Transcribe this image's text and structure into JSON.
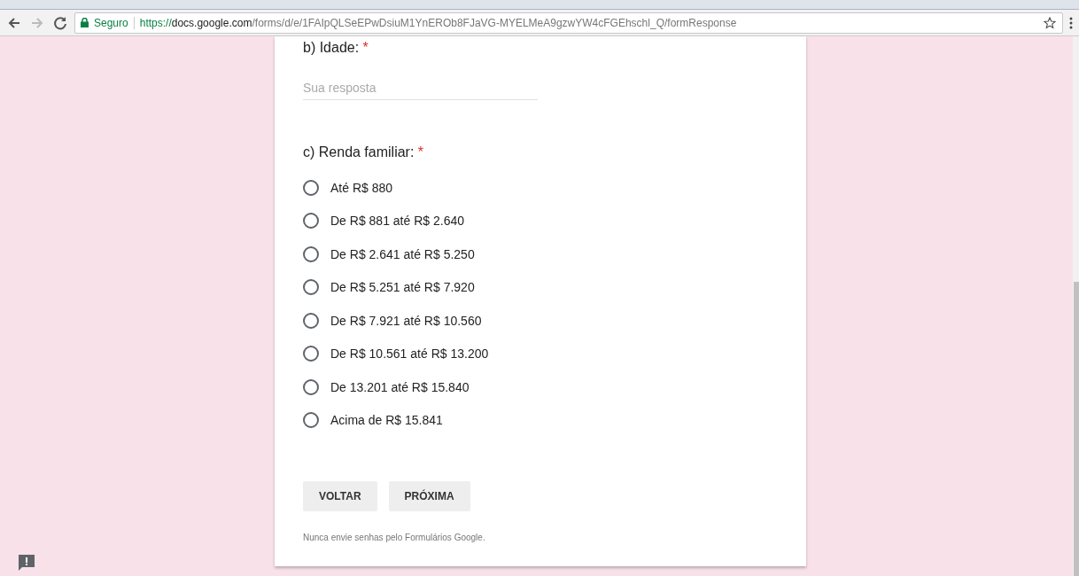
{
  "browser": {
    "security_label": "Seguro",
    "url": {
      "scheme": "https://",
      "host": "docs.google.com",
      "path": "/forms/d/e/1FAIpQLSeEPwDsiuM1YnEROb8FJaVG-MYELMeA9gzwYW4cFGEhschl_Q/formResponse"
    }
  },
  "form": {
    "questions": [
      {
        "kind": "text",
        "title": "b) Idade:",
        "required_mark": "*",
        "placeholder": "Sua resposta"
      },
      {
        "kind": "radio",
        "title": "c) Renda familiar:",
        "required_mark": "*",
        "options": [
          {
            "label": "Até R$ 880",
            "selected": false
          },
          {
            "label": "De R$ 881 até R$ 2.640",
            "selected": false
          },
          {
            "label": "De R$ 2.641 até R$ 5.250",
            "selected": false
          },
          {
            "label": "De R$ 5.251 até R$ 7.920",
            "selected": false
          },
          {
            "label": "De R$ 7.921 até R$ 10.560",
            "selected": false
          },
          {
            "label": "De R$ 10.561 até R$ 13.200",
            "selected": false
          },
          {
            "label": "De 13.201 até R$ 15.840",
            "selected": false
          },
          {
            "label": "Acima de R$ 15.841",
            "selected": false
          }
        ]
      }
    ],
    "buttons": [
      "VOLTAR",
      "PRÓXIMA"
    ],
    "footer": "Nunca envie senhas pelo Formulários Google."
  }
}
